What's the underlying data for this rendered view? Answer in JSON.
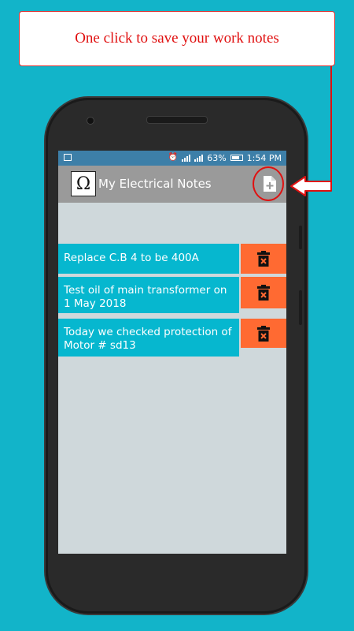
{
  "callout": {
    "text": "One click to save your work notes"
  },
  "status_bar": {
    "battery": "63%",
    "time": "1:54 PM"
  },
  "app_bar": {
    "title": "My Electrical Notes",
    "logo_glyph": "Ω"
  },
  "notes": [
    {
      "text": "Replace C.B 4 to be 400A"
    },
    {
      "text": "Test oil of main transformer on 1 May 2018"
    },
    {
      "text": "Today we checked protection of Motor # sd13"
    }
  ],
  "colors": {
    "background": "#12b4c9",
    "app_bar": "#9a9a9a",
    "note": "#06b7cf",
    "delete": "#ff6a32",
    "callout_text": "#e01010"
  },
  "icons": {
    "add_note": "note-add-icon",
    "delete": "trash-icon",
    "alarm": "alarm-icon",
    "image": "image-icon"
  }
}
